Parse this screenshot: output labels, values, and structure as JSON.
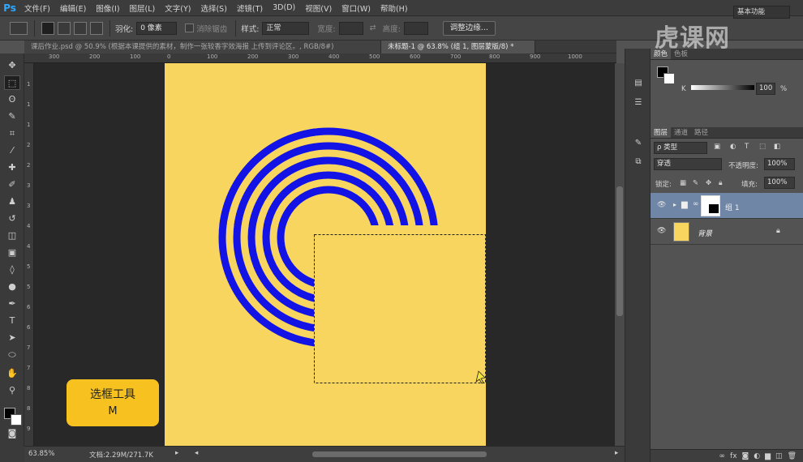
{
  "app": {
    "logo": "Ps"
  },
  "menu": [
    "文件(F)",
    "编辑(E)",
    "图像(I)",
    "图层(L)",
    "文字(Y)",
    "选择(S)",
    "滤镜(T)",
    "3D(D)",
    "视图(V)",
    "窗口(W)",
    "帮助(H)"
  ],
  "options": {
    "feather_label": "羽化:",
    "feather_value": "0 像素",
    "antialias_label": "消除锯齿",
    "style_label": "样式:",
    "style_value": "正常",
    "width_label": "宽度:",
    "height_label": "高度:",
    "refine_edge": "调整边缘...",
    "workspace": "基本功能"
  },
  "watermark": "虎课网",
  "tabs": [
    {
      "label": "课后作业.psd @ 50.9% (根据本课提供的素材，制作一张较香字效海报 上传到评论区。, RGB/8#)",
      "active": false
    },
    {
      "label": "未标题-1 @ 63.8% (组 1, 图层蒙版/8) *",
      "active": true
    }
  ],
  "rulers": {
    "h": [
      "300",
      "200",
      "100",
      "0",
      "100",
      "200",
      "300",
      "400",
      "500",
      "600",
      "700",
      "800",
      "900",
      "1000"
    ],
    "v": [
      "1",
      "1",
      "1",
      "2",
      "2",
      "3",
      "3",
      "4",
      "4",
      "5",
      "5",
      "6",
      "6",
      "7",
      "7",
      "8",
      "8",
      "9"
    ]
  },
  "status": {
    "zoom": "63.85%",
    "doc": "文档:2.29M/271.7K"
  },
  "color_panel": {
    "tabs": [
      "颜色",
      "色板"
    ],
    "k_label": "K",
    "k_value": "100",
    "k_unit": "%"
  },
  "layers_panel": {
    "tabs": [
      "图层",
      "通道",
      "路径"
    ],
    "filter": "ρ 类型",
    "blend_mode": "穿透",
    "opacity_label": "不透明度:",
    "opacity_value": "100%",
    "lock_label": "锁定:",
    "fill_label": "填充:",
    "fill_value": "100%",
    "layers": [
      {
        "name": "组 1",
        "selected": true
      },
      {
        "name": "背景",
        "selected": false
      }
    ]
  },
  "hint": {
    "title": "选框工具",
    "key": "M"
  },
  "colors": {
    "document": "#f8d55e",
    "rings": "#1313e6",
    "hint": "#f7c21f",
    "selected_layer": "#6f86a6"
  }
}
